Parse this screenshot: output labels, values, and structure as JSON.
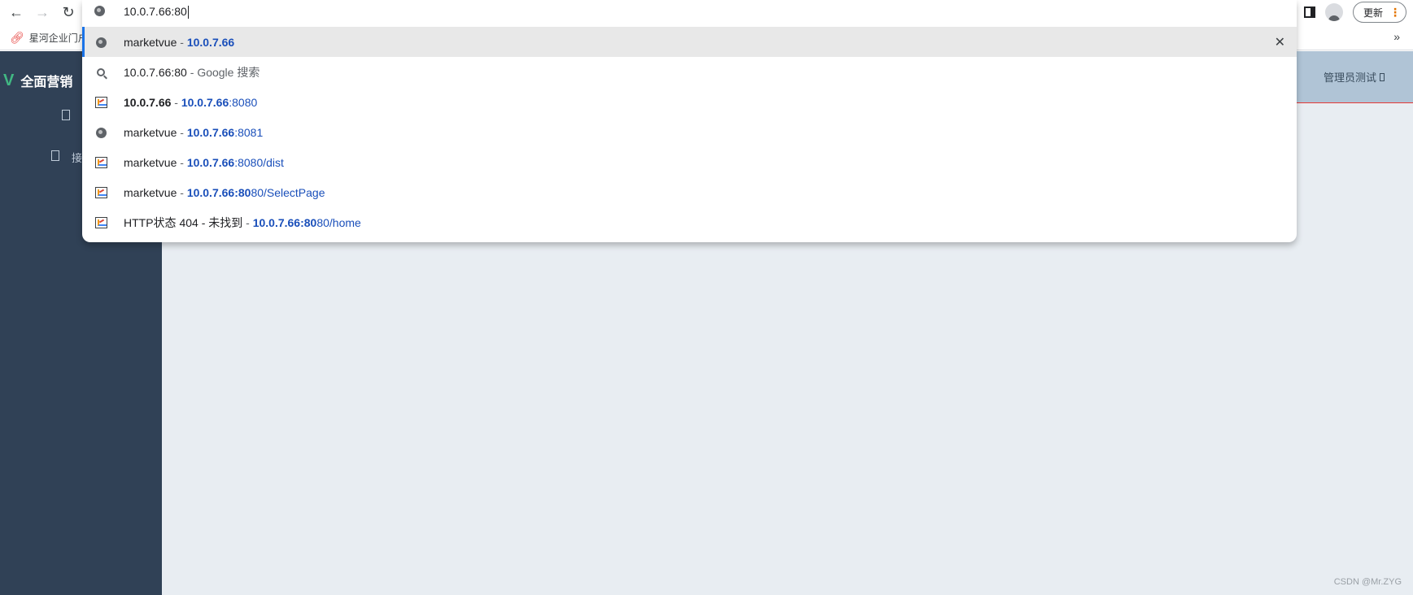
{
  "browser": {
    "nav": {
      "back": "←",
      "forward": "→",
      "reload": "↻"
    },
    "update_label": "更新",
    "update_menu_glyph": "⋮",
    "bookmarks": {
      "item": "星河企业门户",
      "more": "»"
    }
  },
  "omnibox": {
    "input_value": "10.0.7.66:80",
    "suggestions": [
      {
        "icon": "globe-icon",
        "title": "marketvue",
        "sep": " - ",
        "url_bold": "10.0.7.66",
        "url_rest": "",
        "selected": true,
        "removable": true
      },
      {
        "icon": "search-icon",
        "title": "10.0.7.66:80",
        "sep": " - ",
        "url_bold": "",
        "url_rest": "Google 搜索",
        "selected": false
      },
      {
        "icon": "chart-favicon-icon",
        "title": "10.0.7.66",
        "sep": " - ",
        "url_bold": "10.0.7.66",
        "url_rest": ":8080",
        "selected": false
      },
      {
        "icon": "globe-icon",
        "title": "marketvue",
        "sep": " - ",
        "url_bold": "10.0.7.66",
        "url_rest": ":8081",
        "selected": false
      },
      {
        "icon": "chart-favicon-icon",
        "title": "marketvue",
        "sep": " - ",
        "url_bold": "10.0.7.66",
        "url_rest": ":8080/dist",
        "selected": false
      },
      {
        "icon": "chart-favicon-icon",
        "title": "marketvue",
        "sep": " - ",
        "url_bold": "10.0.7.66:80",
        "url_rest": "80/SelectPage",
        "selected": false
      },
      {
        "icon": "chart-favicon-icon",
        "title": "HTTP状态 404 - 未找到",
        "sep": " - ",
        "url_bold": "10.0.7.66:80",
        "url_rest": "80/home",
        "selected": false
      }
    ],
    "remove_glyph": "✕"
  },
  "app": {
    "logo_mark": "V",
    "logo_text": "全面营销",
    "menu_items": [
      {
        "label": ""
      },
      {
        "label": "接"
      }
    ],
    "user_label": "管理员测试"
  },
  "watermark": "CSDN @Mr.ZYG",
  "colors": {
    "sidebar_bg": "#304156",
    "main_bg": "#e8edf2",
    "accent_blue": "#1a4fba",
    "logo_green": "#41b883"
  }
}
